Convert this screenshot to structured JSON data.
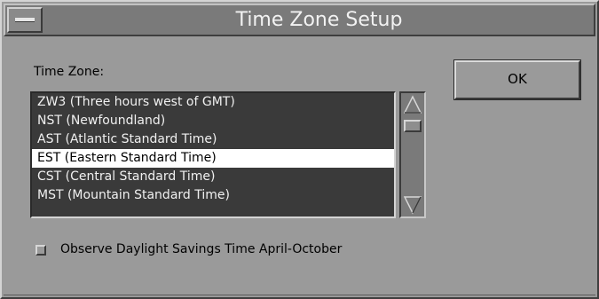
{
  "window": {
    "title": "Time Zone Setup",
    "menu_icon": "window-menu-icon"
  },
  "timezone": {
    "label": "Time Zone:",
    "items": [
      "ZW3 (Three hours west of GMT)",
      "NST (Newfoundland)",
      "AST (Atlantic Standard Time)",
      "EST (Eastern Standard Time)",
      "CST (Central Standard Time)",
      "MST (Mountain Standard Time)"
    ],
    "selected_index": 3
  },
  "scrollbar": {
    "up_icon": "scroll-up-arrow-icon",
    "down_icon": "scroll-down-arrow-icon"
  },
  "buttons": {
    "ok_label": "OK"
  },
  "dst": {
    "label": "Observe Daylight Savings Time April-October",
    "checked": false
  },
  "colors": {
    "window_bg": "#9a9a9a",
    "titlebar_bg": "#7a7a7a",
    "list_bg": "#3a3a3a",
    "list_text": "#f0f0f0",
    "selection_bg": "#ffffff"
  }
}
